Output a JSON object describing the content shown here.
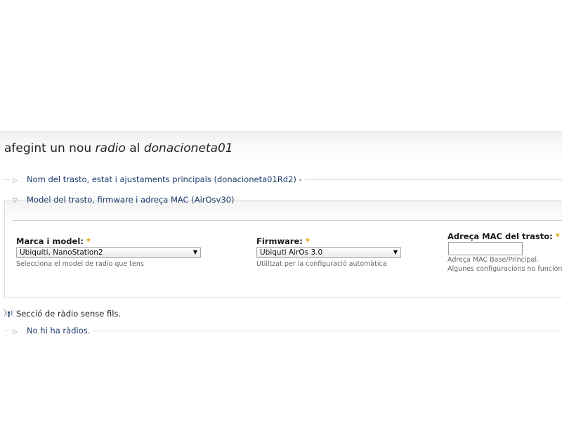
{
  "page": {
    "title_prefix": "afegint un nou ",
    "title_item": "radio",
    "title_middle": " al ",
    "title_target": "donacioneta01"
  },
  "sections": {
    "main_settings": {
      "label": "Nom del trasto, estat i ajustaments principals (donacioneta01Rd2) -",
      "icon": "triangle-right-icon",
      "collapsed": true
    },
    "model": {
      "label": "Model del trasto, firmware i adreça MAC (AirOsv30)",
      "icon": "triangle-down-icon",
      "collapsed": false
    },
    "radios": {
      "label": "No hi ha ràdios.",
      "icon": "triangle-right-icon",
      "collapsed": true
    }
  },
  "form": {
    "model": {
      "label": "Marca i model:",
      "required_mark": "*",
      "selected": "Ubiquiti, NanoStation2",
      "description": "Selecciona el model de radio que tens"
    },
    "firmware": {
      "label": "Firmware:",
      "required_mark": "*",
      "selected": "Ubiquti AirOs 3.0",
      "description": "Utilitzat per la configuració automàtica"
    },
    "mac": {
      "label": "Adreça MAC del trasto:",
      "required_mark": "*",
      "value": "",
      "description_line1": "Adreça MAC Base/Principal.",
      "description_line2": "Algunes configuracions no funcion"
    }
  },
  "wireless": {
    "icon": "wireless-antenna-icon",
    "text": "Secció de ràdio sense fils."
  },
  "colors": {
    "required": "#e2a000",
    "legend_text": "#1b3a6b",
    "border": "#dcdcdc"
  }
}
